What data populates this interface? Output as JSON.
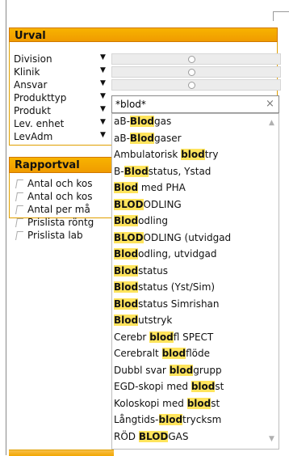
{
  "urval": {
    "title": "Urval",
    "fields": [
      {
        "label": "Division"
      },
      {
        "label": "Klinik"
      },
      {
        "label": "Ansvar"
      },
      {
        "label": "Produkttyp"
      },
      {
        "label": "Produkt"
      },
      {
        "label": "Lev. enhet"
      },
      {
        "label": "LevAdm"
      }
    ]
  },
  "search": {
    "value": "*blod*",
    "clear": "×"
  },
  "dropdown": {
    "items": [
      {
        "pre": "aB-",
        "match": "Blod",
        "post": "gas"
      },
      {
        "pre": "aB-",
        "match": "Blod",
        "post": "gaser"
      },
      {
        "pre": "Ambulatorisk ",
        "match": "blod",
        "post": "try"
      },
      {
        "pre": "B-",
        "match": "Blod",
        "post": "status, Ystad"
      },
      {
        "pre": "",
        "match": "Blod",
        "post": " med PHA"
      },
      {
        "pre": "",
        "match": "BLOD",
        "post": "ODLING"
      },
      {
        "pre": "",
        "match": "Blod",
        "post": "odling"
      },
      {
        "pre": "",
        "match": "BLOD",
        "post": "ODLING (utvidgad"
      },
      {
        "pre": "",
        "match": "Blod",
        "post": "odling, utvidgad"
      },
      {
        "pre": "",
        "match": "Blod",
        "post": "status"
      },
      {
        "pre": "",
        "match": "Blod",
        "post": "status (Yst/Sim)"
      },
      {
        "pre": "",
        "match": "Blod",
        "post": "status Simrishan"
      },
      {
        "pre": "",
        "match": "Blod",
        "post": "utstryk"
      },
      {
        "pre": "Cerebr ",
        "match": "blod",
        "post": "fl SPECT"
      },
      {
        "pre": "Cerebralt ",
        "match": "blod",
        "post": "flöde"
      },
      {
        "pre": "Dubbl svar ",
        "match": "blod",
        "post": "grupp"
      },
      {
        "pre": "EGD-skopi med ",
        "match": "blod",
        "post": "st"
      },
      {
        "pre": "Koloskopi med ",
        "match": "blod",
        "post": "st"
      },
      {
        "pre": "Långtids-",
        "match": "blod",
        "post": "trycksm"
      },
      {
        "pre": "RÖD ",
        "match": "BLOD",
        "post": "GAS"
      }
    ]
  },
  "rapportval": {
    "title": "Rapportval",
    "items": [
      {
        "label": "Antal och kos"
      },
      {
        "label": "Antal och kos"
      },
      {
        "label": "Antal per må"
      },
      {
        "label": "Prislista röntg"
      },
      {
        "label": "Prislista lab"
      }
    ]
  }
}
